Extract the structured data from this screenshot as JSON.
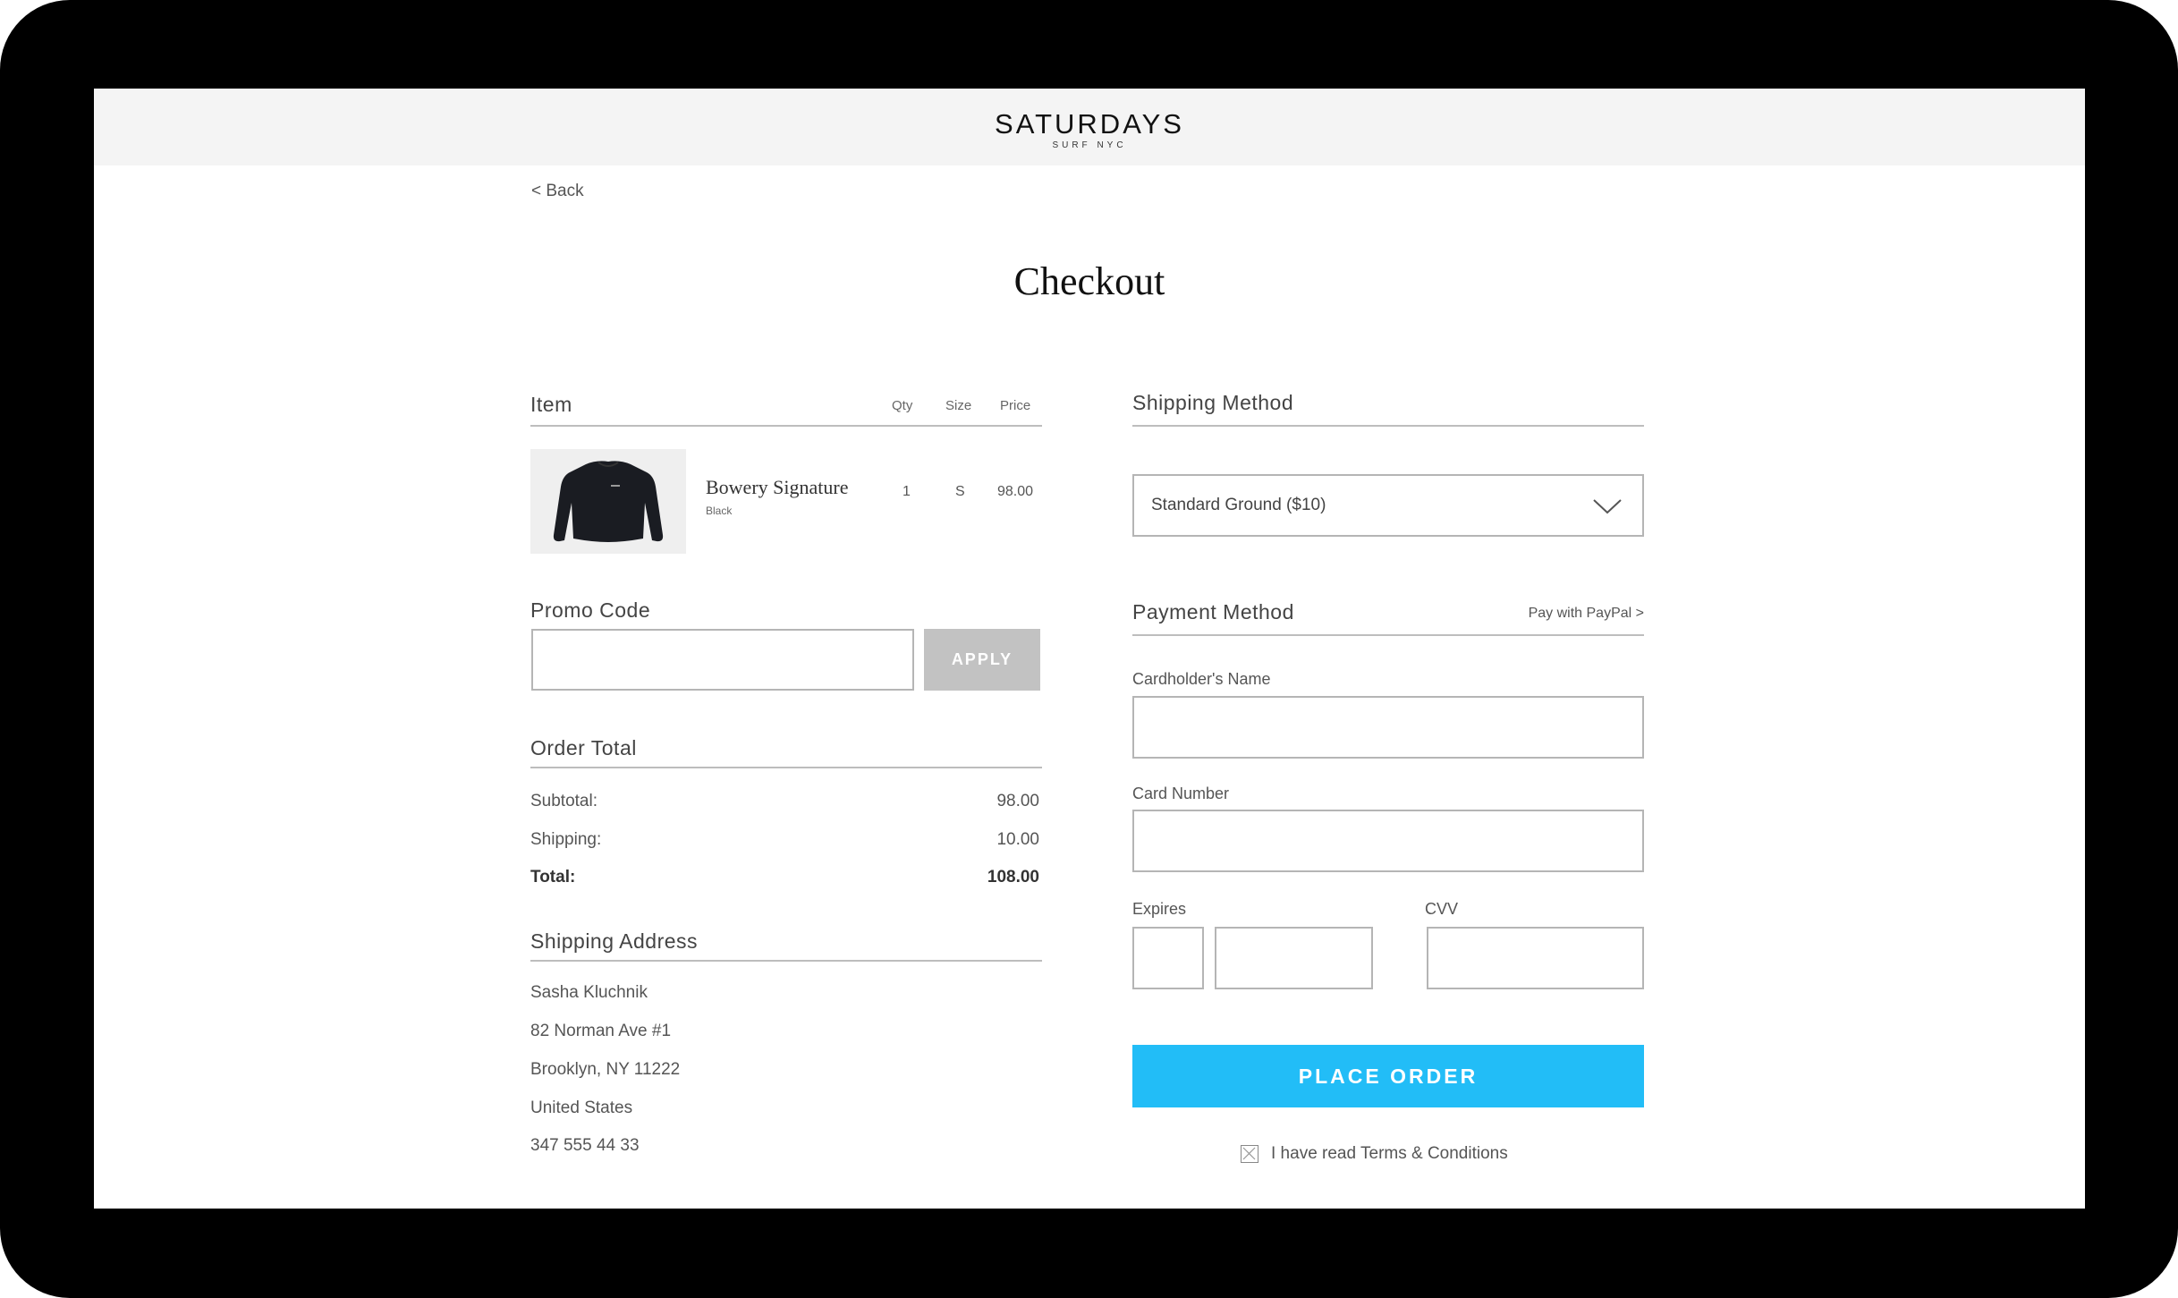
{
  "header": {
    "brand": "SATURDAYS",
    "brand_sub": "SURF NYC"
  },
  "nav": {
    "back": "< Back"
  },
  "page": {
    "title": "Checkout"
  },
  "cart": {
    "heading": "Item",
    "columns": {
      "qty": "Qty",
      "size": "Size",
      "price": "Price"
    },
    "items": [
      {
        "name": "Bowery Signature",
        "variant": "Black",
        "qty": "1",
        "size": "S",
        "price": "98.00",
        "image_icon": "sweatshirt-icon"
      }
    ]
  },
  "promo": {
    "heading": "Promo Code",
    "value": "",
    "placeholder": "",
    "apply_label": "APPLY"
  },
  "order_total": {
    "heading": "Order Total",
    "rows": [
      {
        "label": "Subtotal:",
        "value": "98.00"
      },
      {
        "label": "Shipping:",
        "value": "10.00"
      },
      {
        "label": "Total:",
        "value": "108.00"
      }
    ]
  },
  "shipping_address": {
    "heading": "Shipping Address",
    "lines": [
      "Sasha Kluchnik",
      "82 Norman Ave #1",
      "Brooklyn, NY 11222",
      "United States",
      "347 555 44 33"
    ]
  },
  "shipping_method": {
    "heading": "Shipping Method",
    "selected": "Standard Ground ($10)"
  },
  "payment": {
    "heading": "Payment Method",
    "paypal_link": "Pay with PayPal >",
    "cardholder_label": "Cardholder's Name",
    "card_number_label": "Card Number",
    "expires_label": "Expires",
    "cvv_label": "CVV",
    "place_order_label": "PLACE ORDER",
    "terms_label": "I have read Terms & Conditions"
  },
  "colors": {
    "accent": "#22bdf7",
    "apply_button": "#c2c2c2",
    "topbar": "#f4f4f4"
  }
}
